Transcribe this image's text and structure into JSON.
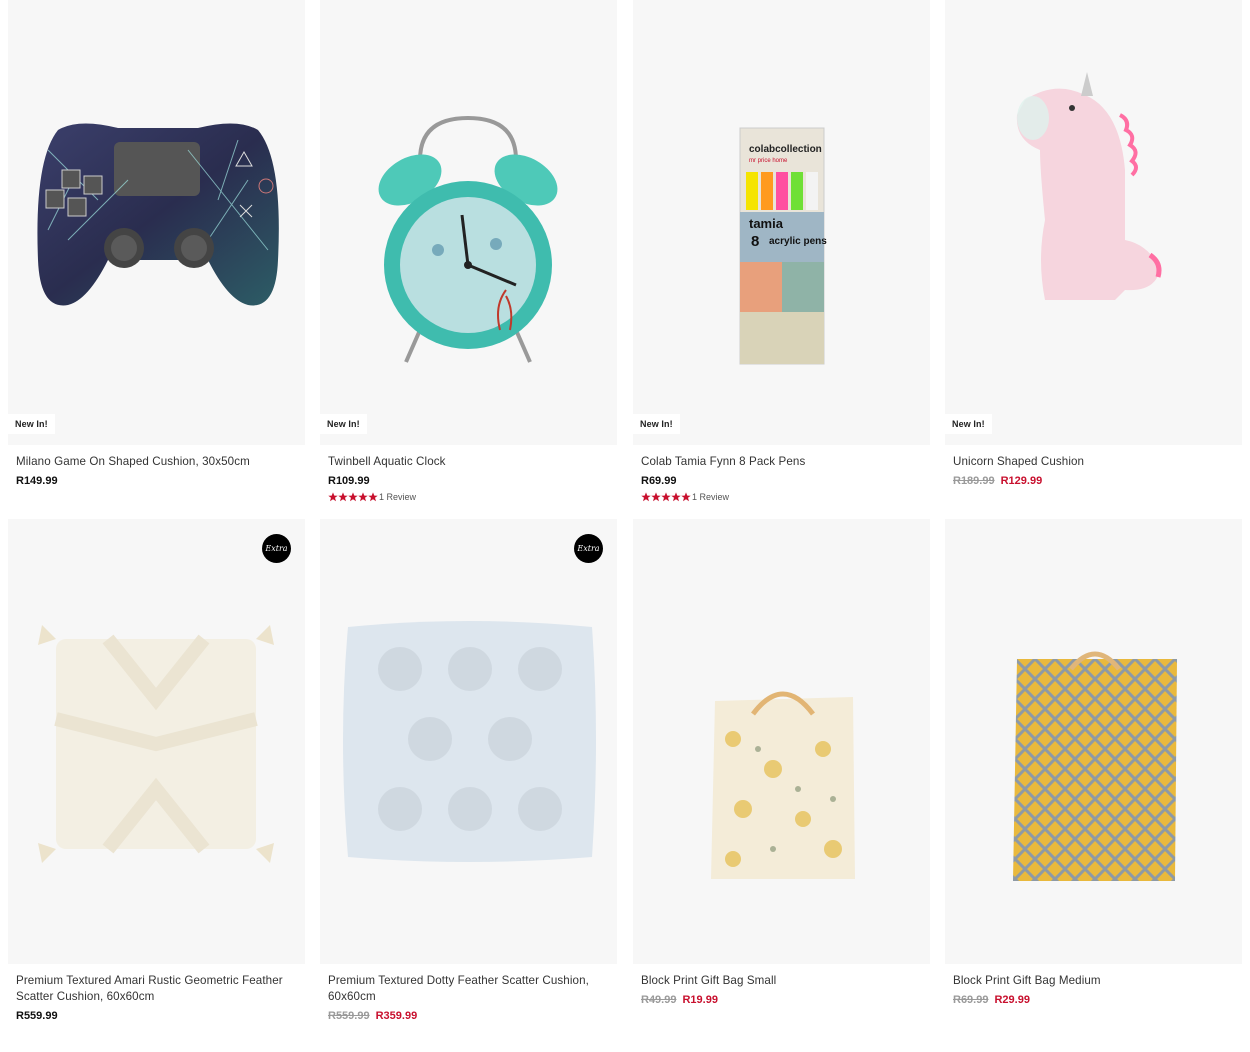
{
  "products": [
    {
      "badge": "New In!",
      "title": "Milano Game On Shaped Cushion, 30x50cm",
      "price": "R149.99",
      "image": "game-controller-cushion-image"
    },
    {
      "badge": "New In!",
      "title": "Twinbell Aquatic Clock",
      "price": "R109.99",
      "rating": 5,
      "review_text": "1 Review",
      "image": "alarm-clock-image"
    },
    {
      "badge": "New In!",
      "title": "Colab Tamia Fynn 8 Pack Pens",
      "price": "R69.99",
      "rating": 5,
      "review_text": "1 Review",
      "image": "acrylic-pens-pack-image"
    },
    {
      "badge": "New In!",
      "title": "Unicorn Shaped Cushion",
      "old_price": "R189.99",
      "sale_price": "R129.99",
      "image": "unicorn-cushion-image"
    },
    {
      "extra_badge": "Extra",
      "title": "Premium Textured Amari Rustic Geometric Feather Scatter Cushion, 60x60cm",
      "price": "R559.99",
      "image": "cream-tassel-cushion-image"
    },
    {
      "extra_badge": "Extra",
      "title": "Premium Textured Dotty Feather Scatter Cushion, 60x60cm",
      "old_price": "R559.99",
      "sale_price": "R359.99",
      "image": "blue-dotty-cushion-image"
    },
    {
      "title": "Block Print Gift Bag Small",
      "old_price": "R49.99",
      "sale_price": "R19.99",
      "image": "gift-bag-small-image"
    },
    {
      "title": "Block Print Gift Bag Medium",
      "old_price": "R69.99",
      "sale_price": "R29.99",
      "image": "gift-bag-medium-image"
    }
  ],
  "pen_pack_text": {
    "brand": "colabcollection",
    "sub": "mr price home",
    "name": "tamia",
    "count": "8",
    "label": "acrylic pens"
  },
  "colors": {
    "sale": "#c8102e",
    "star": "#c8102e",
    "card_bg": "#f7f7f7"
  }
}
